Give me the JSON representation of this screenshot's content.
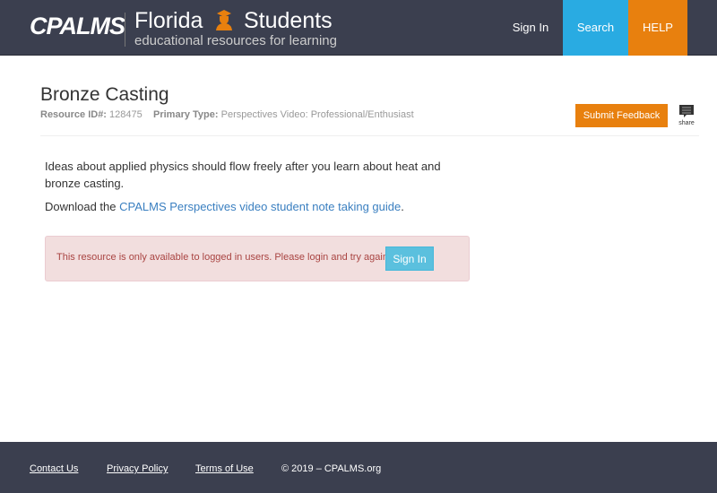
{
  "header": {
    "logo": "CPALMS",
    "title_left": "Florida",
    "title_right": "Students",
    "subtitle": "educational resources for learning",
    "nav": {
      "sign_in": "Sign In",
      "search": "Search",
      "help": "HELP"
    }
  },
  "resource": {
    "title": "Bronze Casting",
    "id_label": "Resource ID#:",
    "id": "128475",
    "type_label": "Primary Type:",
    "type": "Perspectives Video: Professional/Enthusiast",
    "feedback": "Submit Feedback",
    "share": "share"
  },
  "body": {
    "description": "Ideas about applied physics should flow freely after you learn about heat and bronze casting.",
    "download_prefix": "Download the ",
    "download_link": "CPALMS Perspectives video student note taking guide",
    "download_suffix": ".",
    "alert": "This resource is only available to logged in users. Please login and try again.",
    "alert_button": "Sign In"
  },
  "footer": {
    "contact": "Contact Us",
    "privacy": "Privacy Policy",
    "terms": "Terms of Use",
    "copyright": "© 2019 – CPALMS.org"
  },
  "colors": {
    "header": "#3b3f4f",
    "search": "#29abe2",
    "help": "#e8800e"
  }
}
